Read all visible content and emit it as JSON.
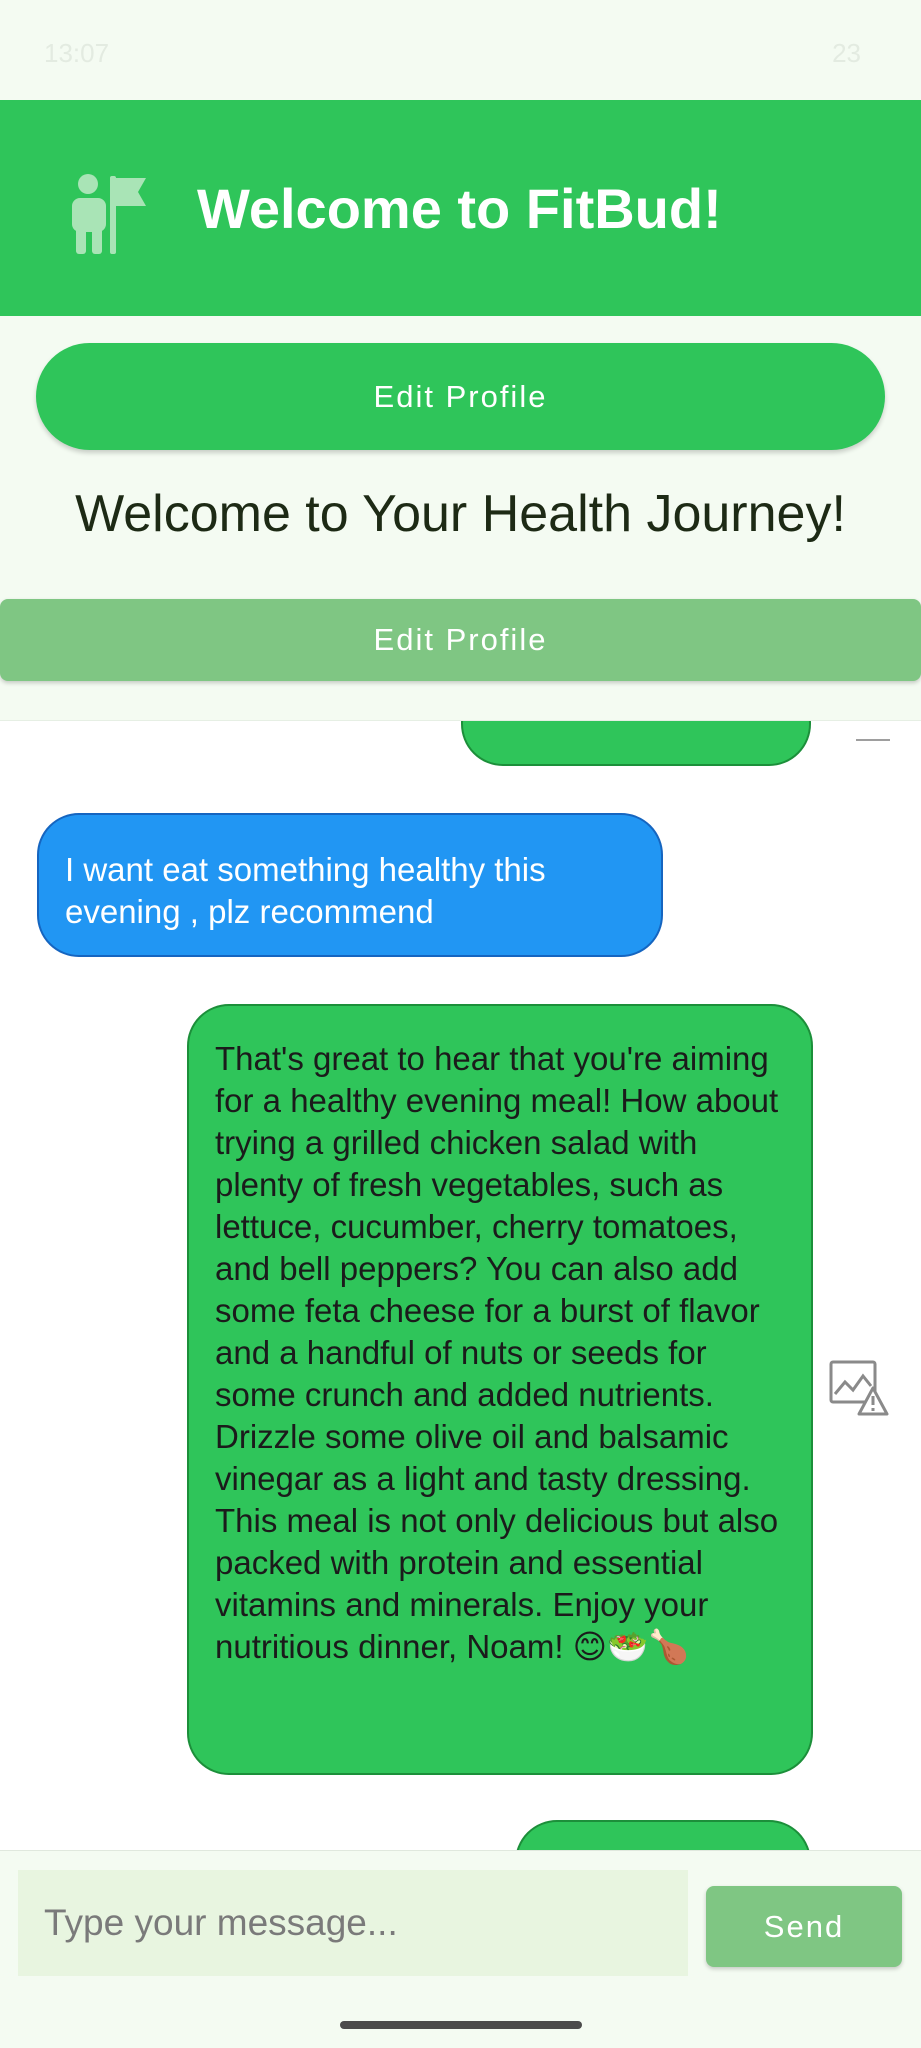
{
  "status_bar": {
    "time": "13:07",
    "right": "23"
  },
  "header": {
    "title": "Welcome to FitBud!",
    "logo_icon": "person-flag-icon"
  },
  "main": {
    "edit_profile_label": "Edit Profile",
    "journey_title": "Welcome to Your Health Journey!",
    "edit_profile_secondary_label": "Edit Profile"
  },
  "chat": {
    "messages": [
      {
        "role": "user",
        "text": "I want eat something healthy this evening , plz recommend"
      },
      {
        "role": "bot",
        "text": "That's great to hear that you're aiming for a healthy evening meal! How about trying a grilled chicken salad with plenty of fresh vegetables, such as lettuce, cucumber, cherry tomatoes, and bell peppers? You can also add some feta cheese for a burst of flavor and a handful of nuts or seeds for some crunch and added nutrients. Drizzle some olive oil and balsamic vinegar as a light and tasty dressing. This meal is not only delicious but also packed with protein and essential vitamins and minerals. Enjoy your nutritious dinner, Noam! 😊🥗🍗"
      }
    ]
  },
  "composer": {
    "placeholder": "Type your message...",
    "send_label": "Send"
  },
  "colors": {
    "primary_green": "#2fc55a",
    "light_green": "#7fc683",
    "user_blue": "#2196f3"
  }
}
